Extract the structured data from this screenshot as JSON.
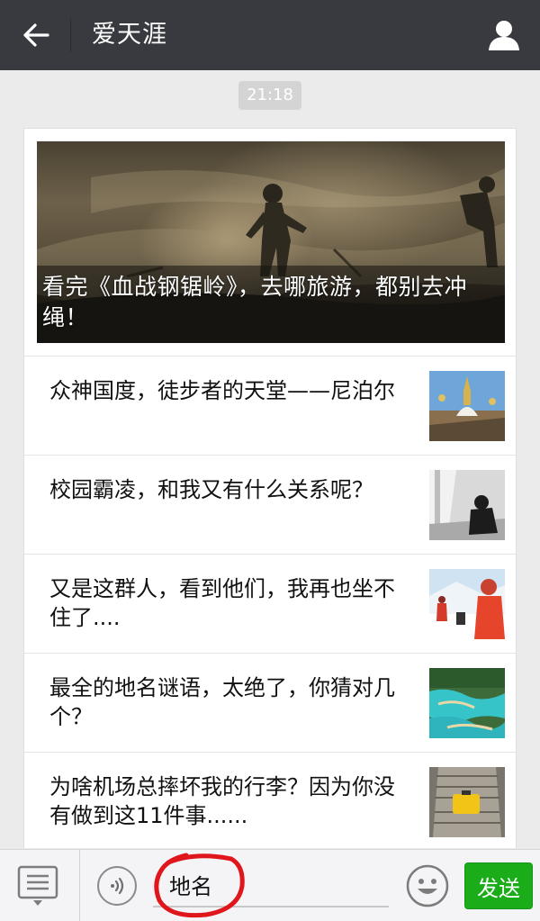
{
  "header": {
    "title": "爱天涯",
    "back_icon": "arrow-left-icon",
    "profile_icon": "user-icon"
  },
  "chat": {
    "timestamp": "21:18"
  },
  "article_card": {
    "hero": {
      "title": "看完《血战钢锯岭》，去哪旅游，都别去冲绳！",
      "image": "soldier-battlefield-photo"
    },
    "items": [
      {
        "title": "众神国度，徒步者的天堂——尼泊尔",
        "image": "nepal-stupa-thumbnail"
      },
      {
        "title": "校园霸凌，和我又有什么关系呢？",
        "image": "sitting-person-thumbnail"
      },
      {
        "title": "又是这群人，看到他们，我再也坐不住了....",
        "image": "skiers-thumbnail"
      },
      {
        "title": "最全的地名谜语，太绝了，你猜对几个？",
        "image": "turquoise-pools-thumbnail"
      },
      {
        "title": "为啥机场总摔坏我的行李？因为你没有做到这11件事......",
        "image": "luggage-escalator-thumbnail"
      }
    ]
  },
  "input_bar": {
    "menu_icon": "menu-list-icon",
    "voice_icon": "voice-icon",
    "input_value": "地名",
    "emoji_icon": "smiley-icon",
    "send_label": "发送"
  },
  "colors": {
    "topbar": "#393a3f",
    "background": "#ebebeb",
    "send_button": "#1aad19",
    "highlight_circle": "#e0161d"
  }
}
